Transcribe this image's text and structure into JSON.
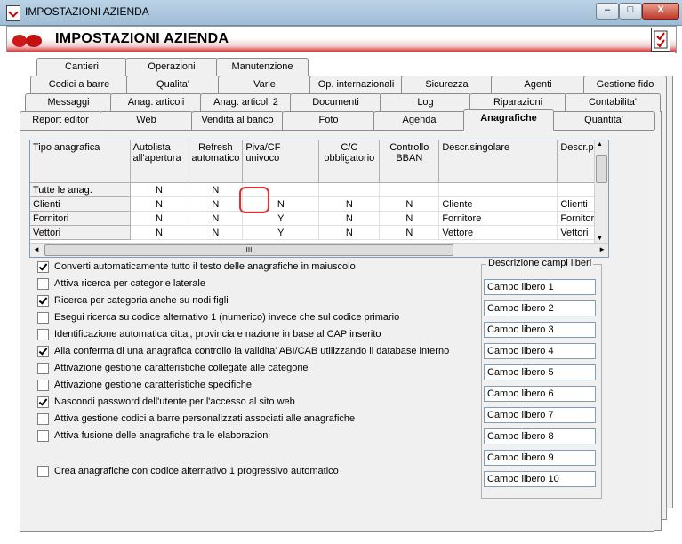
{
  "window": {
    "title": "IMPOSTAZIONI AZIENDA",
    "minimize": "–",
    "maximize": "□",
    "close": "X"
  },
  "banner": {
    "heading": "IMPOSTAZIONI AZIENDA"
  },
  "tabs": {
    "row1": [
      "Cantieri",
      "Operazioni",
      "Manutenzione"
    ],
    "row2": [
      "Codici a barre",
      "Qualita'",
      "Varie",
      "Op. internazionali",
      "Sicurezza",
      "Agenti",
      "Gestione fido"
    ],
    "row3": [
      "Messaggi",
      "Anag. articoli",
      "Anag. articoli 2",
      "Documenti",
      "Log",
      "Riparazioni",
      "Contabilita'"
    ],
    "row4": [
      "Report editor",
      "Web",
      "Vendita al banco",
      "Foto",
      "Agenda",
      "Anagrafiche",
      "Quantita'"
    ],
    "active": "Anagrafiche"
  },
  "grid": {
    "headers": [
      "Tipo anagrafica",
      "Autolista all'apertura",
      "Refresh automatico",
      "Piva/CF univoco",
      "C/C obbligatorio",
      "Controllo BBAN",
      "Descr.singolare",
      "Descr.p"
    ],
    "rows": [
      [
        "Tutte le anag.",
        "N",
        "N",
        "",
        "",
        "",
        "",
        ""
      ],
      [
        "Clienti",
        "N",
        "N",
        "N",
        "N",
        "N",
        "Cliente",
        "Clienti"
      ],
      [
        "Fornitori",
        "N",
        "N",
        "Y",
        "N",
        "N",
        "Fornitore",
        "Fornitori"
      ],
      [
        "Vettori",
        "N",
        "N",
        "Y",
        "N",
        "N",
        "Vettore",
        "Vettori"
      ]
    ],
    "scroll_left": "◄",
    "scroll_right": "►",
    "scroll_up": "▲",
    "scroll_down": "▼",
    "thumb": "III"
  },
  "options": [
    {
      "label": "Converti automaticamente tutto il testo delle anagrafiche in maiuscolo",
      "checked": true
    },
    {
      "label": "Attiva ricerca per categorie laterale",
      "checked": false
    },
    {
      "label": "Ricerca per categoria anche su nodi figli",
      "checked": true
    },
    {
      "label": "Esegui ricerca su codice alternativo 1 (numerico) invece che sul codice primario",
      "checked": false
    },
    {
      "label": "Identificazione automatica citta', provincia e nazione in base al CAP inserito",
      "checked": false
    },
    {
      "label": "Alla conferma di una anagrafica controllo la validita' ABI/CAB utilizzando il database interno",
      "checked": true
    },
    {
      "label": "Attivazione gestione caratteristiche collegate alle categorie",
      "checked": false
    },
    {
      "label": "Attivazione gestione caratteristiche specifiche",
      "checked": false
    },
    {
      "label": "Nascondi password dell'utente per l'accesso al sito web",
      "checked": true
    },
    {
      "label": "Attiva gestione codici a barre personalizzati associati alle anagrafiche",
      "checked": false
    },
    {
      "label": "Attiva fusione delle anagrafiche tra le elaborazioni",
      "checked": false
    },
    {
      "label": "Crea anagrafiche con codice alternativo 1 progressivo automatico",
      "checked": false
    }
  ],
  "free_fields": {
    "legend": "Descrizione campi liberi",
    "fields": [
      "Campo libero 1",
      "Campo libero 2",
      "Campo libero 3",
      "Campo libero 4",
      "Campo libero 5",
      "Campo libero 6",
      "Campo libero 7",
      "Campo libero 8",
      "Campo libero 9",
      "Campo libero 10"
    ]
  },
  "colors": {
    "banner_red": "#d82020",
    "highlight": "#e03030",
    "titlebar": "#bcd3e6"
  }
}
